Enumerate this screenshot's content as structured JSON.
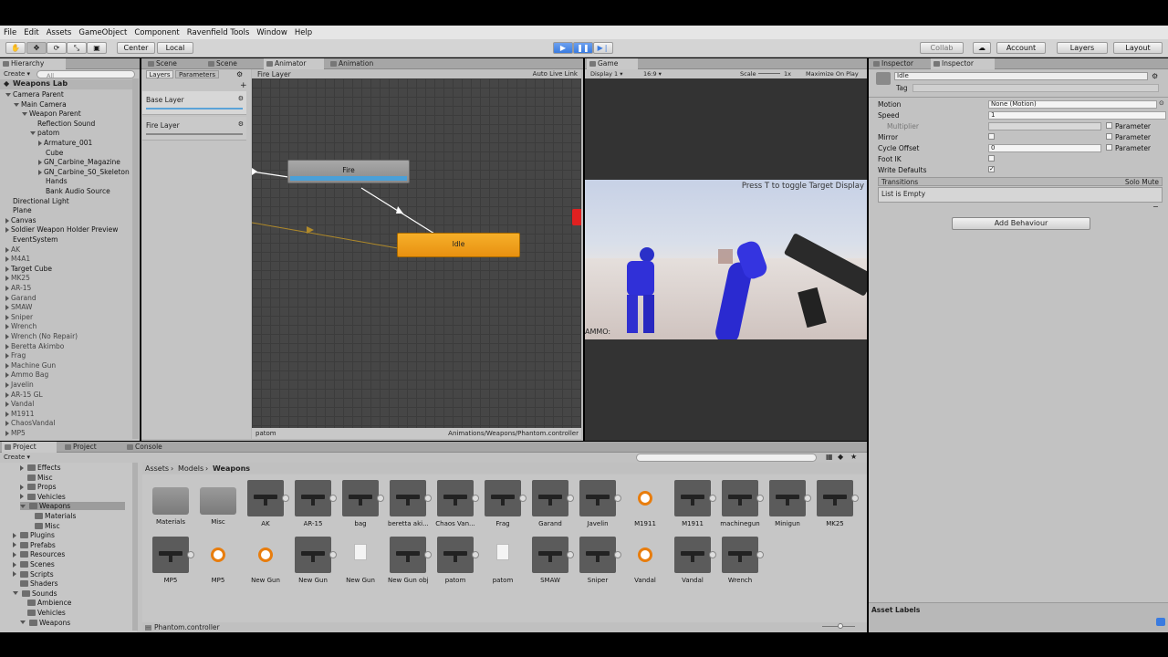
{
  "menu": [
    "File",
    "Edit",
    "Assets",
    "GameObject",
    "Component",
    "Ravenfield Tools",
    "Window",
    "Help"
  ],
  "toolbar": {
    "pivot": "Center",
    "space": "Local",
    "collab": "Collab",
    "account": "Account",
    "layers": "Layers",
    "layout": "Layout"
  },
  "scene_tabs": {
    "hierarchy": "Hierarchy",
    "scene1": "Scene",
    "scene2": "Scene",
    "animator": "Animator",
    "animation": "Animation",
    "game": "Game",
    "inspector1": "Inspector",
    "inspector2": "Inspector"
  },
  "hierarchy": {
    "create": "Create",
    "search_placeholder": "All",
    "scene_name": "Weapons Lab",
    "items": [
      {
        "label": "Camera Parent",
        "indent": 0,
        "arrow": "down",
        "dim": false
      },
      {
        "label": "Main Camera",
        "indent": 1,
        "arrow": "down",
        "dim": false
      },
      {
        "label": "Weapon Parent",
        "indent": 2,
        "arrow": "down",
        "dim": false
      },
      {
        "label": "Reflection Sound",
        "indent": 3,
        "arrow": "",
        "dim": false
      },
      {
        "label": "patom",
        "indent": 3,
        "arrow": "down",
        "dim": false
      },
      {
        "label": "Armature_001",
        "indent": 4,
        "arrow": "right",
        "dim": false
      },
      {
        "label": "Cube",
        "indent": 4,
        "arrow": "",
        "dim": false
      },
      {
        "label": "GN_Carbine_Magazine",
        "indent": 4,
        "arrow": "right",
        "dim": false
      },
      {
        "label": "GN_Carbine_S0_Skeleton",
        "indent": 4,
        "arrow": "right",
        "dim": false
      },
      {
        "label": "Hands",
        "indent": 4,
        "arrow": "",
        "dim": false
      },
      {
        "label": "Bank Audio Source",
        "indent": 4,
        "arrow": "",
        "dim": false
      },
      {
        "label": "Directional Light",
        "indent": 0,
        "arrow": "",
        "dim": false
      },
      {
        "label": "Plane",
        "indent": 0,
        "arrow": "",
        "dim": false
      },
      {
        "label": "Canvas",
        "indent": 0,
        "arrow": "right",
        "dim": false
      },
      {
        "label": "Soldier Weapon Holder Preview",
        "indent": 0,
        "arrow": "right",
        "dim": false
      },
      {
        "label": "EventSystem",
        "indent": 0,
        "arrow": "",
        "dim": false
      },
      {
        "label": "AK",
        "indent": 0,
        "arrow": "right",
        "dim": true
      },
      {
        "label": "M4A1",
        "indent": 0,
        "arrow": "right",
        "dim": true
      },
      {
        "label": "Target Cube",
        "indent": 0,
        "arrow": "right",
        "dim": false
      },
      {
        "label": "MK25",
        "indent": 0,
        "arrow": "right",
        "dim": true
      },
      {
        "label": "AR-15",
        "indent": 0,
        "arrow": "right",
        "dim": true
      },
      {
        "label": "Garand",
        "indent": 0,
        "arrow": "right",
        "dim": true
      },
      {
        "label": "SMAW",
        "indent": 0,
        "arrow": "right",
        "dim": true
      },
      {
        "label": "Sniper",
        "indent": 0,
        "arrow": "right",
        "dim": true
      },
      {
        "label": "Wrench",
        "indent": 0,
        "arrow": "right",
        "dim": true
      },
      {
        "label": "Wrench (No Repair)",
        "indent": 0,
        "arrow": "right",
        "dim": true
      },
      {
        "label": "Beretta Akimbo",
        "indent": 0,
        "arrow": "right",
        "dim": true
      },
      {
        "label": "Frag",
        "indent": 0,
        "arrow": "right",
        "dim": true
      },
      {
        "label": "Machine Gun",
        "indent": 0,
        "arrow": "right",
        "dim": true
      },
      {
        "label": "Ammo Bag",
        "indent": 0,
        "arrow": "right",
        "dim": true
      },
      {
        "label": "Javelin",
        "indent": 0,
        "arrow": "right",
        "dim": true
      },
      {
        "label": "AR-15 GL",
        "indent": 0,
        "arrow": "right",
        "dim": true
      },
      {
        "label": "Vandal",
        "indent": 0,
        "arrow": "right",
        "dim": true
      },
      {
        "label": "M1911",
        "indent": 0,
        "arrow": "right",
        "dim": true
      },
      {
        "label": "ChaosVandal",
        "indent": 0,
        "arrow": "right",
        "dim": true
      },
      {
        "label": "MP5",
        "indent": 0,
        "arrow": "right",
        "dim": true
      }
    ]
  },
  "animator": {
    "layers_tab": "Layers",
    "params_tab": "Parameters",
    "breadcrumb": "Fire Layer",
    "auto_live_link": "Auto Live Link",
    "layer_list": [
      "Base Layer",
      "Fire Layer"
    ],
    "state_fire": "Fire",
    "state_idle": "Idle",
    "footer_left": "patom",
    "footer_right": "Animations/Weapons/Phantom.controller"
  },
  "game": {
    "display": "Display 1",
    "aspect": "16:9",
    "scale_label": "Scale",
    "scale_value": "1x",
    "maximize": "Maximize On Play",
    "hint": "Press T to toggle Target Display",
    "ammo": "AMMO: "
  },
  "inspector": {
    "name": "Idle",
    "tag_label": "Tag",
    "motion_label": "Motion",
    "motion_value": "None (Motion)",
    "speed_label": "Speed",
    "speed_value": "1",
    "multiplier_label": "Multiplier",
    "mirror_label": "Mirror",
    "cycle_label": "Cycle Offset",
    "cycle_value": "0",
    "footik_label": "Foot IK",
    "write_label": "Write Defaults",
    "parameter_label": "Parameter",
    "transitions_label": "Transitions",
    "solo_mute": "Solo Mute",
    "list_empty": "List is Empty",
    "add_behaviour": "Add Behaviour",
    "asset_labels": "Asset Labels"
  },
  "project": {
    "tab_project1": "Project",
    "tab_project2": "Project",
    "tab_console": "Console",
    "create": "Create",
    "breadcrumb": [
      "Assets",
      "Models",
      "Weapons"
    ],
    "tree": [
      {
        "label": "Effects",
        "indent": 1,
        "arrow": "right"
      },
      {
        "label": "Misc",
        "indent": 1,
        "arrow": ""
      },
      {
        "label": "Props",
        "indent": 1,
        "arrow": "right"
      },
      {
        "label": "Vehicles",
        "indent": 1,
        "arrow": "right"
      },
      {
        "label": "Weapons",
        "indent": 1,
        "arrow": "down"
      },
      {
        "label": "Materials",
        "indent": 2,
        "arrow": ""
      },
      {
        "label": "Misc",
        "indent": 2,
        "arrow": ""
      },
      {
        "label": "Plugins",
        "indent": 0,
        "arrow": "right"
      },
      {
        "label": "Prefabs",
        "indent": 0,
        "arrow": "right"
      },
      {
        "label": "Resources",
        "indent": 0,
        "arrow": "right"
      },
      {
        "label": "Scenes",
        "indent": 0,
        "arrow": "right"
      },
      {
        "label": "Scripts",
        "indent": 0,
        "arrow": "right"
      },
      {
        "label": "Shaders",
        "indent": 0,
        "arrow": ""
      },
      {
        "label": "Sounds",
        "indent": 0,
        "arrow": "down"
      },
      {
        "label": "Ambience",
        "indent": 1,
        "arrow": ""
      },
      {
        "label": "Vehicles",
        "indent": 1,
        "arrow": ""
      },
      {
        "label": "Weapons",
        "indent": 1,
        "arrow": "down"
      }
    ],
    "assets_row1": [
      {
        "label": "Materials",
        "kind": "fold"
      },
      {
        "label": "Misc",
        "kind": "fold"
      },
      {
        "label": "AK",
        "kind": "gun"
      },
      {
        "label": "AR-15",
        "kind": "gun"
      },
      {
        "label": "bag",
        "kind": "gun"
      },
      {
        "label": "beretta aki...",
        "kind": "gun"
      },
      {
        "label": "Chaos Van...",
        "kind": "gun"
      },
      {
        "label": "Frag",
        "kind": "gun"
      },
      {
        "label": "Garand",
        "kind": "gun"
      },
      {
        "label": "Javelin",
        "kind": "gun"
      },
      {
        "label": "M1911",
        "kind": "blend"
      },
      {
        "label": "M1911",
        "kind": "gun"
      },
      {
        "label": "machinegun",
        "kind": "gun"
      },
      {
        "label": "Minigun",
        "kind": "gun"
      },
      {
        "label": "MK25",
        "kind": "gun"
      }
    ],
    "assets_row2": [
      {
        "label": "MP5",
        "kind": "gun"
      },
      {
        "label": "MP5",
        "kind": "blend"
      },
      {
        "label": "New Gun",
        "kind": "blend"
      },
      {
        "label": "New Gun",
        "kind": "gun"
      },
      {
        "label": "New Gun",
        "kind": "file"
      },
      {
        "label": "New Gun obj",
        "kind": "gun"
      },
      {
        "label": "patom",
        "kind": "gun"
      },
      {
        "label": "patom",
        "kind": "file"
      },
      {
        "label": "SMAW",
        "kind": "gun"
      },
      {
        "label": "Sniper",
        "kind": "gun"
      },
      {
        "label": "Vandal",
        "kind": "blend"
      },
      {
        "label": "Vandal",
        "kind": "gun"
      },
      {
        "label": "Wrench",
        "kind": "gun"
      }
    ],
    "status_file": "Phantom.controller"
  },
  "colors": {
    "idle_state": "#f0a020",
    "fire_state_bar": "#4aa0d8",
    "play_button": "#3a7be0",
    "game_bg": "#333333",
    "sky": "#c0cbe0"
  }
}
